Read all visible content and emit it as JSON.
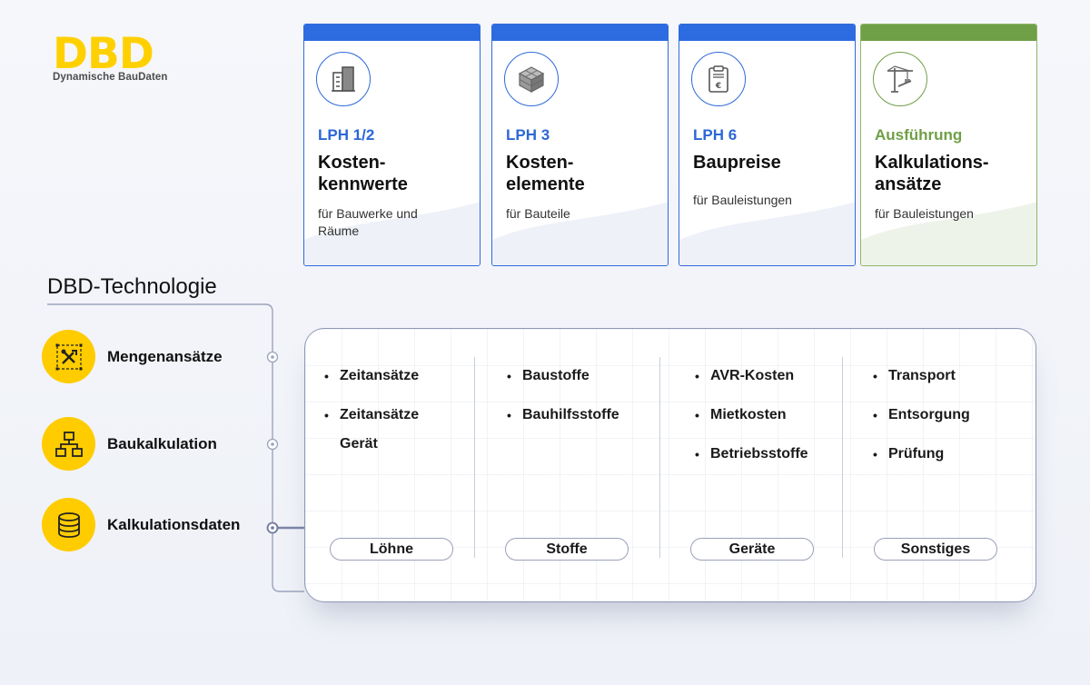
{
  "logo": {
    "mark": "DBD",
    "subtitle": "Dynamische BauDaten"
  },
  "colors": {
    "blue": "#2d6be0",
    "green": "#6f9f46",
    "yellow": "#ffcc00"
  },
  "cards": [
    {
      "icon": "building-icon",
      "phase": "LPH 1/2",
      "title": "Kosten-\nkennwerte",
      "subtitle": "für Bauwerke und Räume"
    },
    {
      "icon": "cube-icon",
      "phase": "LPH 3",
      "title": "Kosten-\nelemente",
      "subtitle": "für Bauteile"
    },
    {
      "icon": "clipboard-euro-icon",
      "phase": "LPH 6",
      "title": "Baupreise",
      "subtitle": "für Bauleistungen"
    },
    {
      "icon": "crane-icon",
      "phase": "Ausführung",
      "title": "Kalkulations-\nansätze",
      "subtitle": "für Bauleistungen"
    }
  ],
  "technology": {
    "title": "DBD-Technologie",
    "items": [
      {
        "icon": "tools-icon",
        "label": "Mengenansätze"
      },
      {
        "icon": "hierarchy-icon",
        "label": "Baukalkulation"
      },
      {
        "icon": "database-icon",
        "label": "Kalkulationsdaten"
      }
    ]
  },
  "columns": [
    {
      "items": [
        "Zeitansätze",
        "Zeitansätze Gerät"
      ],
      "label": "Löhne"
    },
    {
      "items": [
        "Baustoffe",
        "Bauhilfsstoffe"
      ],
      "label": "Stoffe"
    },
    {
      "items": [
        "AVR-Kosten",
        "Mietkosten",
        "Betriebsstoffe"
      ],
      "label": "Geräte"
    },
    {
      "items": [
        "Transport",
        "Entsorgung",
        "Prüfung"
      ],
      "label": "Sonstiges"
    }
  ]
}
